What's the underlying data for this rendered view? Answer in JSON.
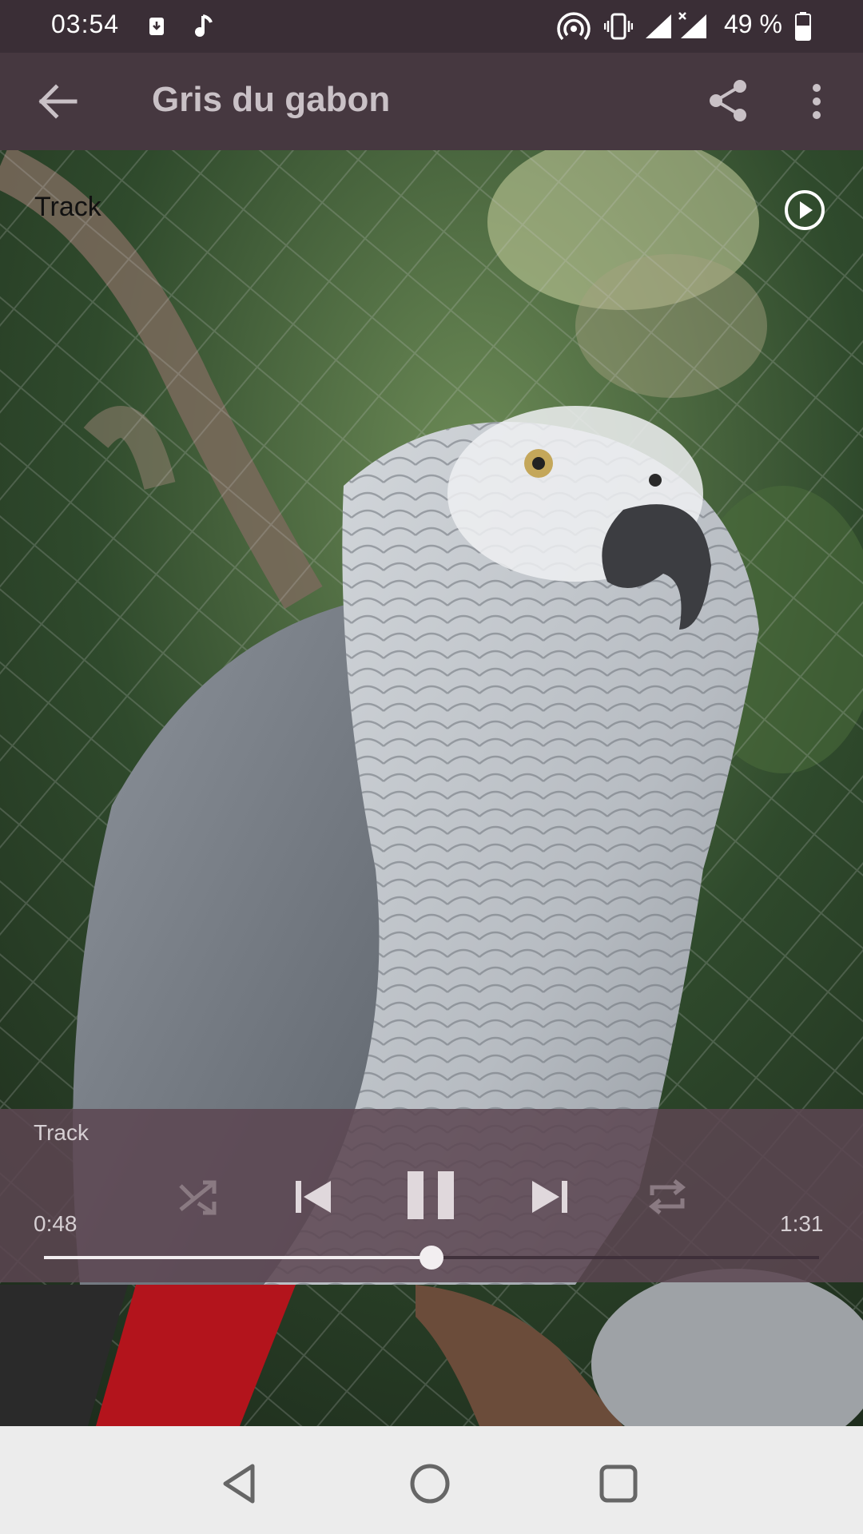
{
  "status_bar": {
    "time": "03:54",
    "battery": "49 %",
    "icons": [
      "download-notification-icon",
      "music-note-icon",
      "hotspot-icon",
      "vibrate-icon",
      "signal-icon",
      "signal-x-icon",
      "battery-icon"
    ]
  },
  "app_bar": {
    "title": "Gris du gabon",
    "icons": [
      "back-arrow-icon",
      "share-icon",
      "overflow-menu-icon"
    ]
  },
  "content": {
    "track_label": "Track",
    "play_icon": "play-circle-icon"
  },
  "player": {
    "track_label": "Track",
    "current_time": "0:48",
    "total_time": "1:31",
    "progress": 0.5,
    "controls": [
      "shuffle-icon",
      "previous-icon",
      "pause-icon",
      "next-icon",
      "repeat-icon"
    ]
  },
  "nav_bar": {
    "icons": [
      "nav-back-icon",
      "nav-home-icon",
      "nav-recents-icon"
    ]
  },
  "colors": {
    "status_bar": "#3a2e36",
    "app_bar": "#463840",
    "player_panel": "#5c4652"
  }
}
